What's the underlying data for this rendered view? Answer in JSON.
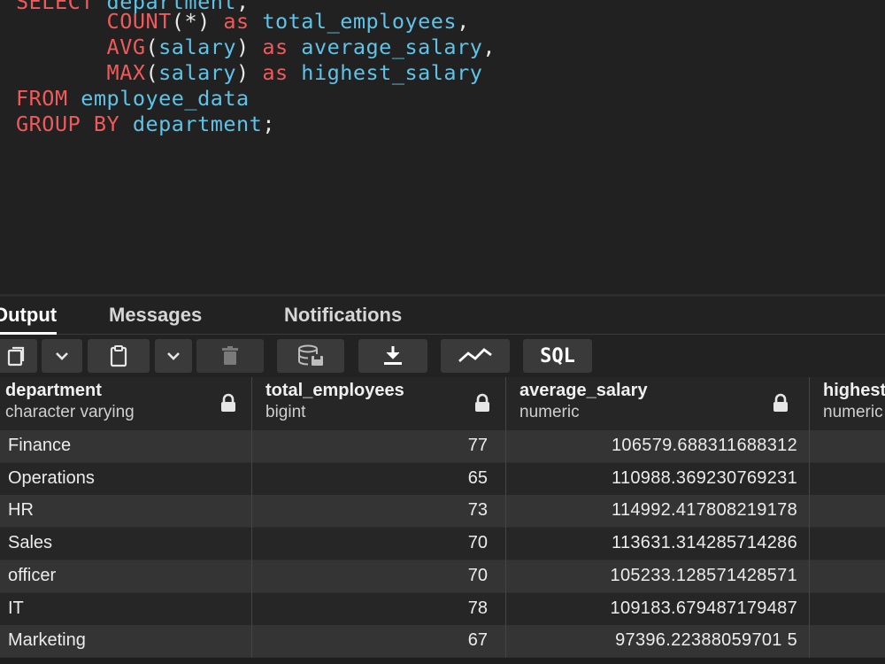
{
  "editor": {
    "lines": [
      [
        {
          "t": "kw",
          "v": "SELECT"
        },
        {
          "t": "pn",
          "v": " "
        },
        {
          "t": "id",
          "v": "department"
        },
        {
          "t": "pn",
          "v": ","
        }
      ],
      [
        {
          "t": "pn",
          "v": "       "
        },
        {
          "t": "fn",
          "v": "COUNT"
        },
        {
          "t": "pn",
          "v": "(*) "
        },
        {
          "t": "kw",
          "v": "as"
        },
        {
          "t": "pn",
          "v": " "
        },
        {
          "t": "id",
          "v": "total_employees"
        },
        {
          "t": "pn",
          "v": ","
        }
      ],
      [
        {
          "t": "pn",
          "v": "       "
        },
        {
          "t": "fn",
          "v": "AVG"
        },
        {
          "t": "pn",
          "v": "("
        },
        {
          "t": "id",
          "v": "salary"
        },
        {
          "t": "pn",
          "v": ") "
        },
        {
          "t": "kw",
          "v": "as"
        },
        {
          "t": "pn",
          "v": " "
        },
        {
          "t": "id",
          "v": "average_salary"
        },
        {
          "t": "pn",
          "v": ","
        }
      ],
      [
        {
          "t": "pn",
          "v": "       "
        },
        {
          "t": "fn",
          "v": "MAX"
        },
        {
          "t": "pn",
          "v": "("
        },
        {
          "t": "id",
          "v": "salary"
        },
        {
          "t": "pn",
          "v": ") "
        },
        {
          "t": "kw",
          "v": "as"
        },
        {
          "t": "pn",
          "v": " "
        },
        {
          "t": "id",
          "v": "highest_salary"
        }
      ],
      [
        {
          "t": "kw",
          "v": "FROM"
        },
        {
          "t": "pn",
          "v": " "
        },
        {
          "t": "id",
          "v": "employee_data"
        }
      ],
      [
        {
          "t": "kw",
          "v": "GROUP BY"
        },
        {
          "t": "pn",
          "v": " "
        },
        {
          "t": "id",
          "v": "department"
        },
        {
          "t": "pn",
          "v": ";"
        }
      ]
    ]
  },
  "tabs": {
    "output": "Output",
    "messages": "Messages",
    "notifications": "Notifications"
  },
  "toolbar": {
    "sql_label": "SQL",
    "icons": [
      "copy-icon",
      "chevron-down-icon",
      "paste-icon",
      "chevron-down-icon",
      "delete-icon",
      "save-data-icon",
      "download-icon",
      "graph-icon"
    ]
  },
  "grid": {
    "columns": [
      {
        "name": "department",
        "type": "character varying"
      },
      {
        "name": "total_employees",
        "type": "bigint"
      },
      {
        "name": "average_salary",
        "type": "numeric"
      },
      {
        "name": "highest_salary",
        "type": "numeric"
      }
    ],
    "rows": [
      [
        "Finance",
        "77",
        "106579.688311688312",
        ""
      ],
      [
        "Operations",
        "65",
        "110988.369230769231",
        ""
      ],
      [
        "HR",
        "73",
        "114992.417808219178",
        ""
      ],
      [
        "Sales",
        "70",
        "113631.314285714286",
        ""
      ],
      [
        "officer",
        "70",
        "105233.128571428571",
        ""
      ],
      [
        "IT",
        "78",
        "109183.679487179487",
        ""
      ],
      [
        "Marketing",
        "67",
        "97396.22388059701 5",
        ""
      ]
    ]
  }
}
